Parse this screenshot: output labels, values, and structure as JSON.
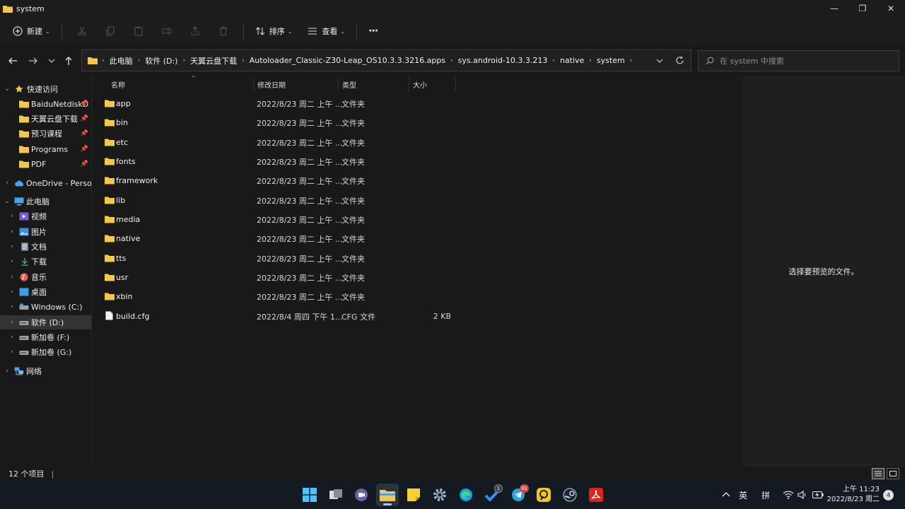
{
  "window": {
    "title": "system",
    "controls": {
      "minimize": "—",
      "maximize": "❐",
      "close": "✕"
    }
  },
  "commandbar": {
    "new_label": "新建",
    "sort_label": "排序",
    "view_label": "查看",
    "more_label": "···"
  },
  "address": {
    "crumbs": [
      "此电脑",
      "软件 (D:)",
      "天翼云盘下载",
      "Autoloader_Classic-Z30-Leap_OS10.3.3.3216.apps",
      "sys.android-10.3.3.213",
      "native",
      "system"
    ]
  },
  "search": {
    "placeholder": "在 system 中搜索"
  },
  "sidebar": {
    "quick_access": "快速访问",
    "pinned": [
      "BaiduNetdiskD",
      "天翼云盘下载",
      "预习课程",
      "Programs",
      "PDF"
    ],
    "onedrive": "OneDrive - Personal",
    "this_pc": "此电脑",
    "pc_items": [
      "视频",
      "图片",
      "文档",
      "下载",
      "音乐",
      "桌面",
      "Windows (C:)",
      "软件 (D:)",
      "新加卷 (F:)",
      "新加卷 (G:)"
    ],
    "network": "网络"
  },
  "columns": {
    "name": "名称",
    "date": "修改日期",
    "type": "类型",
    "size": "大小"
  },
  "files": [
    {
      "name": "app",
      "date": "2022/8/23 周二 上午 ...",
      "type": "文件夹",
      "size": "",
      "kind": "folder"
    },
    {
      "name": "bin",
      "date": "2022/8/23 周二 上午 ...",
      "type": "文件夹",
      "size": "",
      "kind": "folder"
    },
    {
      "name": "etc",
      "date": "2022/8/23 周二 上午 ...",
      "type": "文件夹",
      "size": "",
      "kind": "folder"
    },
    {
      "name": "fonts",
      "date": "2022/8/23 周二 上午 ...",
      "type": "文件夹",
      "size": "",
      "kind": "folder"
    },
    {
      "name": "framework",
      "date": "2022/8/23 周二 上午 ...",
      "type": "文件夹",
      "size": "",
      "kind": "folder"
    },
    {
      "name": "lib",
      "date": "2022/8/23 周二 上午 ...",
      "type": "文件夹",
      "size": "",
      "kind": "folder"
    },
    {
      "name": "media",
      "date": "2022/8/23 周二 上午 ...",
      "type": "文件夹",
      "size": "",
      "kind": "folder"
    },
    {
      "name": "native",
      "date": "2022/8/23 周二 上午 ...",
      "type": "文件夹",
      "size": "",
      "kind": "folder"
    },
    {
      "name": "tts",
      "date": "2022/8/23 周二 上午 ...",
      "type": "文件夹",
      "size": "",
      "kind": "folder"
    },
    {
      "name": "usr",
      "date": "2022/8/23 周二 上午 ...",
      "type": "文件夹",
      "size": "",
      "kind": "folder"
    },
    {
      "name": "xbin",
      "date": "2022/8/23 周二 上午 ...",
      "type": "文件夹",
      "size": "",
      "kind": "folder"
    },
    {
      "name": "build.cfg",
      "date": "2022/8/4 周四 下午 1...",
      "type": "CFG 文件",
      "size": "2 KB",
      "kind": "file"
    }
  ],
  "preview": {
    "message": "选择要预览的文件。"
  },
  "status": {
    "count": "12 个项目",
    "divider": "|"
  },
  "taskbar": {
    "badges": {
      "todo": "1",
      "telegram": "41"
    },
    "tray": {
      "ime_lang": "英",
      "ime_mode": "拼"
    },
    "clock": {
      "time": "上午 11:23",
      "date": "2022/8/23 周二"
    },
    "notifications": "4"
  },
  "colors": {
    "folder": "#f2c84b",
    "accent": "#4cc2ff",
    "background": "#191919"
  }
}
